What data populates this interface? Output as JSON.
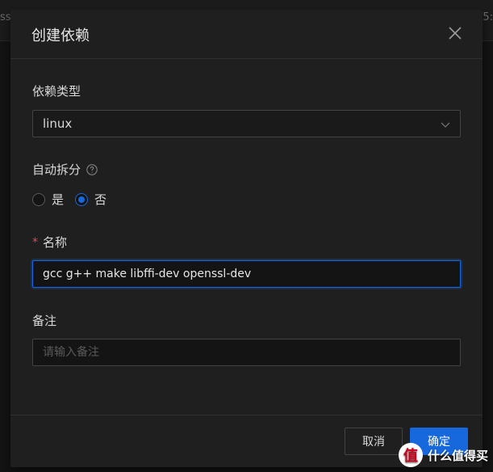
{
  "backdrop": {
    "left_fragment": "ss",
    "right_fragment": "05:"
  },
  "dialog": {
    "title": "创建依赖",
    "fields": {
      "dep_type": {
        "label": "依赖类型",
        "value": "linux"
      },
      "auto_split": {
        "label": "自动拆分",
        "options": [
          {
            "label": "是",
            "checked": false
          },
          {
            "label": "否",
            "checked": true
          }
        ]
      },
      "name": {
        "required_mark": "*",
        "label": "名称",
        "value": "gcc g++ make libffi-dev openssl-dev"
      },
      "remark": {
        "label": "备注",
        "placeholder": "请输入备注",
        "value": ""
      }
    },
    "footer": {
      "cancel_label": "取消",
      "ok_label": "确定"
    }
  },
  "watermark": {
    "logo_glyph": "值",
    "text": "什么值得买"
  },
  "colors": {
    "primary": "#1668dc",
    "required": "#e84749",
    "modal_bg": "#1f1f1f"
  }
}
